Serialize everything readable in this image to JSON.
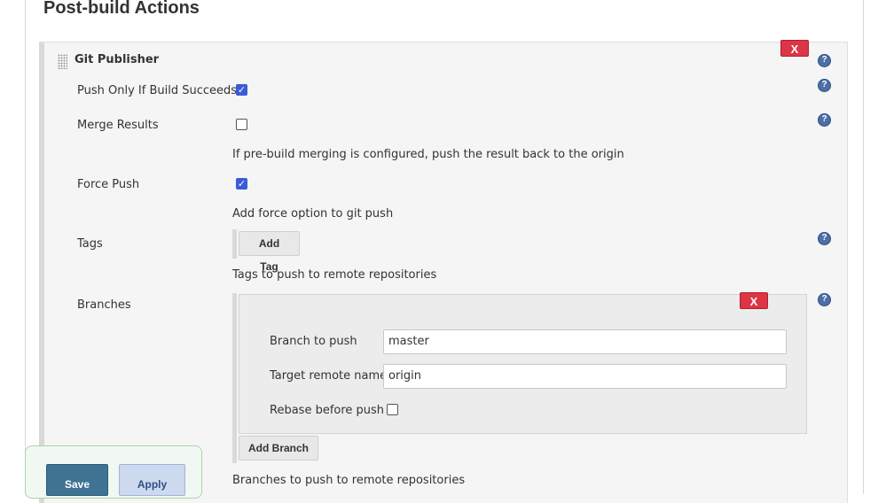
{
  "section": {
    "title": "Post-build Actions"
  },
  "publisher": {
    "title": "Git Publisher",
    "delete_label": "X",
    "push_only_if_success": {
      "label": "Push Only If Build Succeeds",
      "checked": true
    },
    "merge_results": {
      "label": "Merge Results",
      "checked": false,
      "description": "If pre-build merging is configured, push the result back to the origin"
    },
    "force_push": {
      "label": "Force Push",
      "checked": true,
      "description": "Add force option to git push"
    },
    "tags": {
      "label": "Tags",
      "add_button": "Add Tag",
      "description": "Tags to push to remote repositories"
    },
    "branches": {
      "label": "Branches",
      "delete_label": "X",
      "branch_to_push": {
        "label": "Branch to push",
        "value": "master"
      },
      "target_remote": {
        "label": "Target remote name",
        "value": "origin"
      },
      "rebase": {
        "label": "Rebase before push",
        "checked": false
      },
      "add_button": "Add Branch",
      "description": "Branches to push to remote repositories"
    }
  },
  "help_icon_glyph": "?",
  "checkbox_check_glyph": "✓",
  "footer": {
    "save_label": "Save",
    "apply_label": "Apply"
  },
  "colors": {
    "delete_button": "#dc3545",
    "help_icon": "#4d6fa5",
    "checkbox_checked": "#3a5bd9",
    "save_button": "#3e7393",
    "apply_button": "#cdd9ef"
  }
}
